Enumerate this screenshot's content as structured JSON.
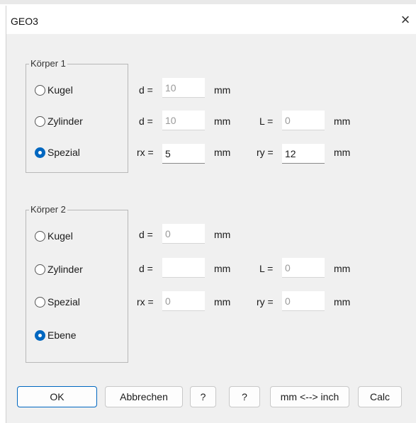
{
  "window": {
    "title": "GEO3",
    "close_symbol": "×"
  },
  "koerper1": {
    "legend": "Körper 1",
    "radios": {
      "kugel": "Kugel",
      "zylinder": "Zylinder",
      "spezial": "Spezial"
    },
    "selected": "Spezial",
    "kugel": {
      "d_label": "d =",
      "d_value": "10",
      "unit": "mm"
    },
    "zylinder": {
      "d_label": "d =",
      "d_value": "10",
      "unit": "mm",
      "l_label": "L =",
      "l_value": "0",
      "l_unit": "mm"
    },
    "spezial": {
      "rx_label": "rx =",
      "rx_value": "5",
      "unit": "mm",
      "ry_label": "ry =",
      "ry_value": "12",
      "ry_unit": "mm"
    }
  },
  "koerper2": {
    "legend": "Körper 2",
    "radios": {
      "kugel": "Kugel",
      "zylinder": "Zylinder",
      "spezial": "Spezial",
      "ebene": "Ebene"
    },
    "selected": "Ebene",
    "kugel": {
      "d_label": "d =",
      "d_value": "0",
      "unit": "mm"
    },
    "zylinder": {
      "d_label": "d =",
      "d_value": "",
      "unit": "mm",
      "l_label": "L =",
      "l_value": "0",
      "l_unit": "mm"
    },
    "spezial": {
      "rx_label": "rx =",
      "rx_value": "0",
      "unit": "mm",
      "ry_label": "ry =",
      "ry_value": "0",
      "ry_unit": "mm"
    }
  },
  "buttons": {
    "ok": "OK",
    "cancel": "Abbrechen",
    "help1": "?",
    "help2": "?",
    "convert": "mm <--> inch",
    "calc": "Calc"
  },
  "colors": {
    "accent": "#0067c0",
    "dialog_bg": "#f0f0f0",
    "disabled_text": "#9a9a9a"
  }
}
